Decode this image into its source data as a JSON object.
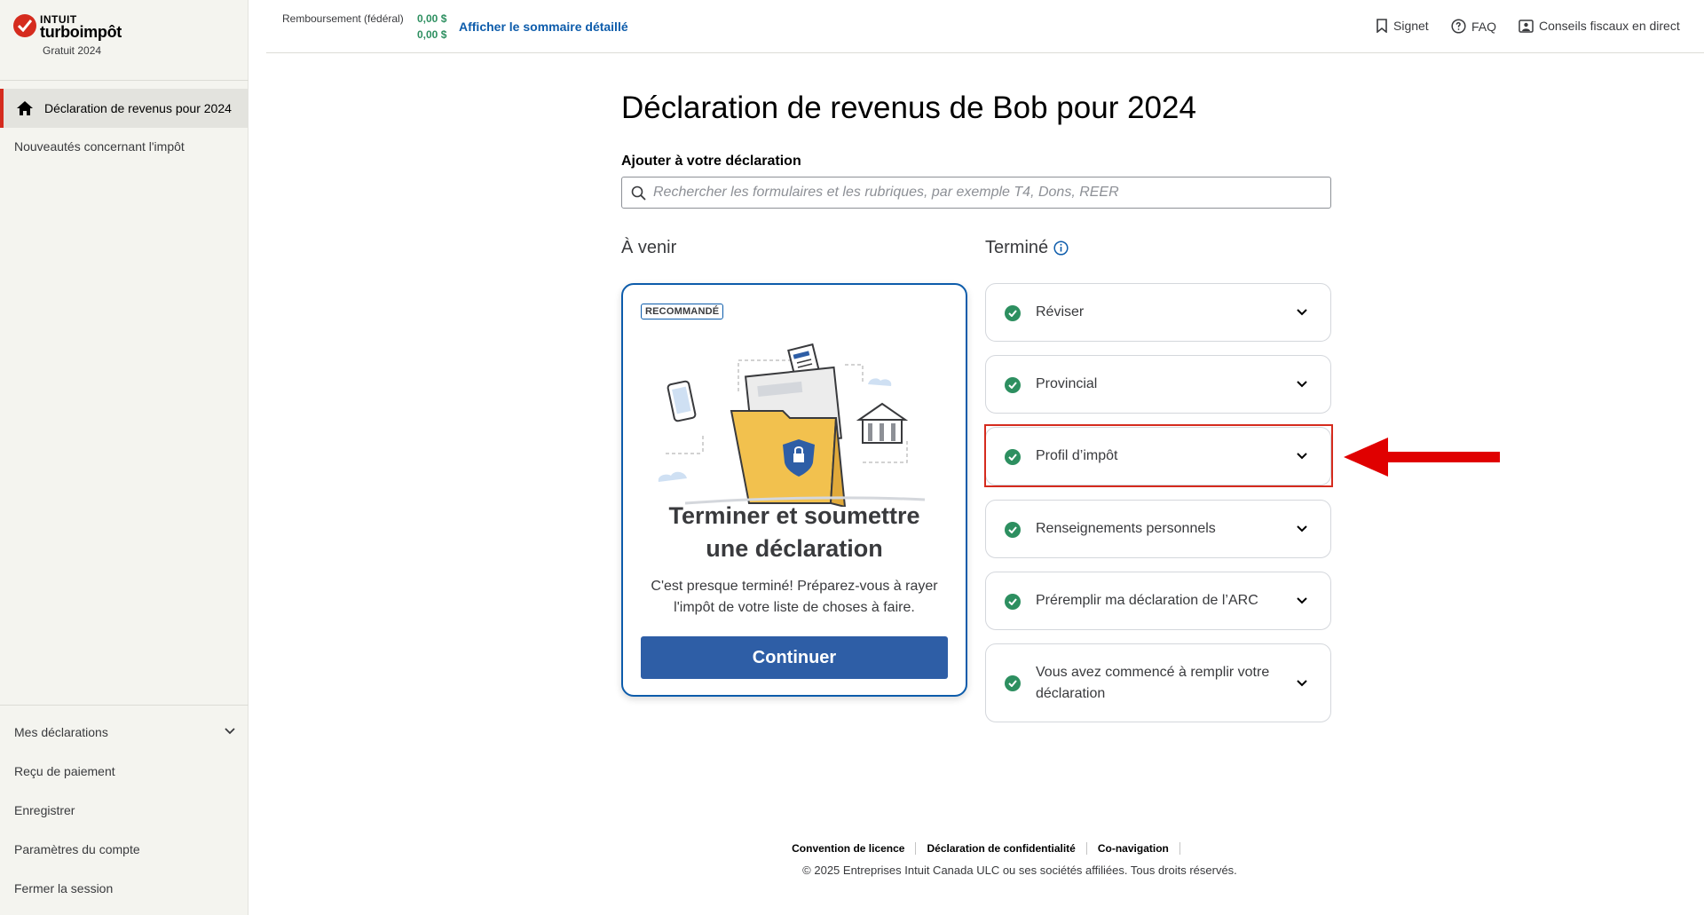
{
  "brand": {
    "intuit": "INTUIT",
    "product": "turboimpôt",
    "plan": "Gratuit 2024"
  },
  "sidebar": {
    "top_items": [
      {
        "label": "Déclaration de revenus pour 2024",
        "icon": "home-icon",
        "active": true
      },
      {
        "label": "Nouveautés concernant l'impôt"
      }
    ],
    "bottom_items": [
      {
        "label": "Mes déclarations",
        "icon": "chevron-down-icon"
      },
      {
        "label": "Reçu de paiement"
      },
      {
        "label": "Enregistrer"
      },
      {
        "label": "Paramètres du compte"
      },
      {
        "label": "Fermer la session"
      }
    ]
  },
  "topbar": {
    "refund_label": "Remboursement (fédéral)",
    "refund_amount_1": "0,00  $",
    "refund_amount_2": "0,00  $",
    "summary_link": "Afficher le sommaire détaillé",
    "bookmark": "Signet",
    "faq": "FAQ",
    "live_advice": "Conseils fiscaux en direct"
  },
  "main": {
    "title": "Déclaration de revenus de Bob pour 2024",
    "add_label": "Ajouter à votre déclaration",
    "search_placeholder": "Rechercher les formulaires et les rubriques, par exemple T4, Dons, REER",
    "upcoming_heading": "À venir",
    "done_heading": "Terminé"
  },
  "upcoming_card": {
    "badge": "RECOMMANDÉ",
    "title": "Terminer et soumettre une déclaration",
    "description": "C'est presque terminé! Préparez-vous à rayer l'impôt de votre liste de choses à faire.",
    "button": "Continuer"
  },
  "done_items": [
    {
      "label": "Réviser"
    },
    {
      "label": "Provincial"
    },
    {
      "label": "Profil d’impôt"
    },
    {
      "label": "Renseignements personnels"
    },
    {
      "label": "Préremplir ma déclaration de l’ARC"
    },
    {
      "label": "Vous avez commencé à remplir votre déclaration"
    }
  ],
  "footer": {
    "links": [
      "Convention de licence",
      "Déclaration de confidentialité",
      "Co-navigation"
    ],
    "copyright": "© 2025 Entreprises Intuit Canada ULC ou ses sociétés affiliées. Tous droits réservés."
  },
  "colors": {
    "accent_red": "#d52b1e",
    "link_blue": "#0d5cab",
    "button_blue": "#2e5ea6",
    "success_green": "#2d8f60"
  }
}
